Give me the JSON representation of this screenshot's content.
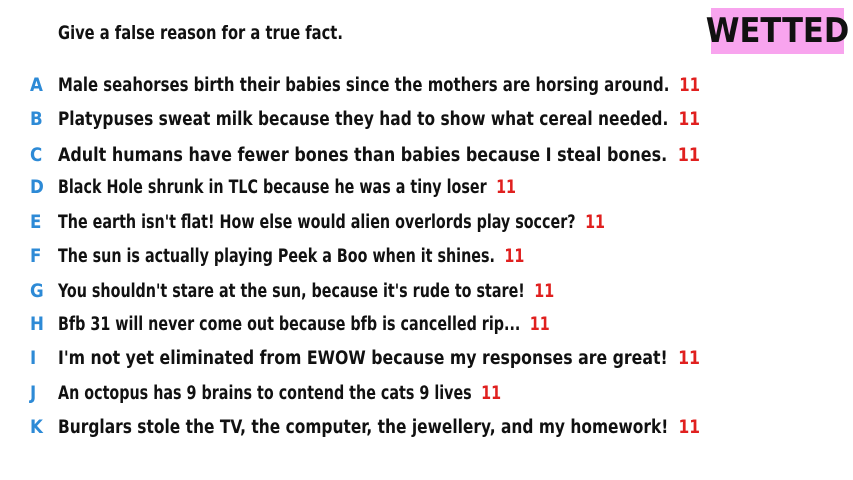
{
  "prompt": "Give a false reason for a true fact.",
  "badge": {
    "label": "WETTED",
    "color": "#f8a4ee"
  },
  "colors": {
    "letter": "#2d8ad6",
    "score": "#e0201f",
    "text": "#111111"
  },
  "responses": [
    {
      "letter": "A",
      "text": "Male seahorses birth their babies since the mothers are horsing around.",
      "score": "11"
    },
    {
      "letter": "B",
      "text": "Platypuses sweat milk because they had to show what cereal needed.",
      "score": "11"
    },
    {
      "letter": "C",
      "text": "Adult humans have fewer bones than babies because I steal bones.",
      "score": "11"
    },
    {
      "letter": "D",
      "text": "Black Hole shrunk in TLC because he was a tiny loser",
      "score": "11"
    },
    {
      "letter": "E",
      "text": "The earth isn't flat! How else would alien overlords play soccer?",
      "score": "11"
    },
    {
      "letter": "F",
      "text": "The sun is actually playing Peek a Boo when it shines.",
      "score": "11"
    },
    {
      "letter": "G",
      "text": "You shouldn't stare at the sun, because it's rude to stare!",
      "score": "11"
    },
    {
      "letter": "H",
      "text": "Bfb 31 will never come out because bfb is cancelled rip...",
      "score": "11"
    },
    {
      "letter": "I",
      "text": "I'm not yet eliminated from EWOW because my responses are great!",
      "score": "11"
    },
    {
      "letter": "J",
      "text": "An octopus has 9 brains to contend the cats 9 lives",
      "score": "11"
    },
    {
      "letter": "K",
      "text": "Burglars stole the TV, the computer, the jewellery, and my homework!",
      "score": "11"
    }
  ]
}
